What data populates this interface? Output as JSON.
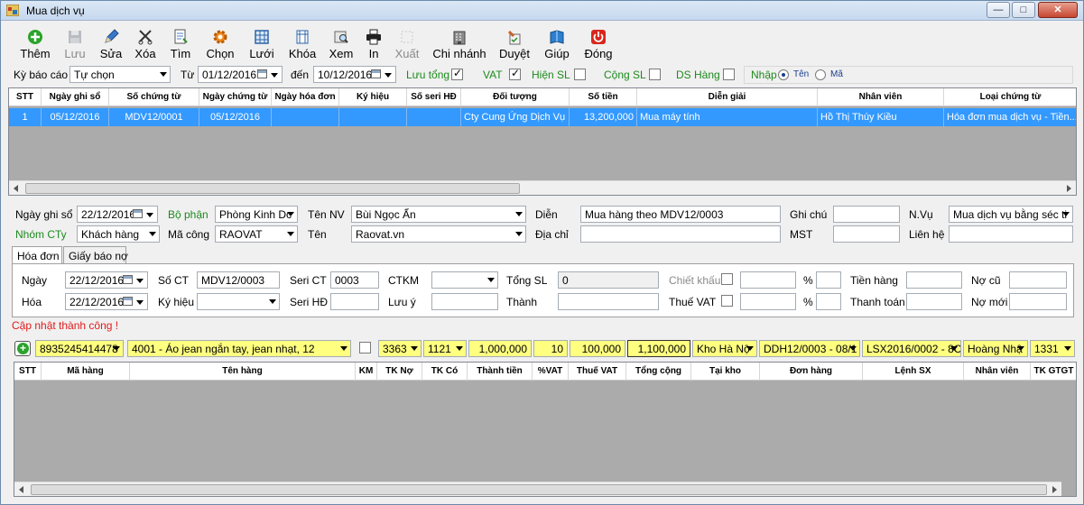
{
  "window": {
    "title": "Mua dịch vụ",
    "min": "—",
    "max": "□",
    "close": "✕"
  },
  "toolbar": {
    "them": "Thêm",
    "luu": "Lưu",
    "sua": "Sửa",
    "xoa": "Xóa",
    "tim": "Tìm",
    "chon": "Chọn",
    "luoi": "Lưới",
    "khoa": "Khóa",
    "xem": "Xem",
    "in": "In",
    "xuat": "Xuất",
    "chinhanh": "Chi nhánh",
    "duyet": "Duyệt",
    "giup": "Giúp",
    "dong": "Đóng"
  },
  "filter": {
    "ky_bao_cao_label": "Kỳ báo cáo",
    "ky_bao_cao_value": "Tự chọn",
    "tu_label": "Từ",
    "tu_value": "01/12/2016",
    "den_label": "đến",
    "den_value": "10/12/2016",
    "luu_tong": "Lưu tổng",
    "vat": "VAT",
    "hien_sl": "Hiện SL",
    "cong_sl": "Cộng SL",
    "ds_hang": "DS Hàng",
    "nhap": "Nhập",
    "ten": "Tên",
    "ma": "Mã"
  },
  "master_grid": {
    "headers": [
      "STT",
      "Ngày ghi sổ",
      "Số chứng từ",
      "Ngày chứng từ",
      "Ngày hóa đơn",
      "Ký hiệu",
      "Số seri HĐ",
      "Đối tượng",
      "Số tiền",
      "Diễn giải",
      "Nhân viên",
      "Loại chứng từ"
    ],
    "rows": [
      [
        "1",
        "05/12/2016",
        "MDV12/0001",
        "05/12/2016",
        "",
        "",
        "",
        "Cty Cung Ứng Dịch Vụ",
        "13,200,000",
        "Mua máy tính",
        "Hồ Thị Thúy Kiều",
        "Hóa đơn mua dịch vụ - Tiền..."
      ]
    ]
  },
  "form": {
    "ngay_ghi_so_label": "Ngày ghi sổ",
    "ngay_ghi_so": "22/12/2016",
    "bo_phan_label": "Bộ phận",
    "bo_phan": "Phòng Kinh Dc",
    "ten_nv_label": "Tên NV",
    "ten_nv": "Bùi Ngọc Ẩn",
    "dien_label": "Diễn",
    "dien": "Mua hàng theo MDV12/0003",
    "ghi_chu_label": "Ghi chú",
    "ghi_chu": "",
    "nvu_label": "N.Vụ",
    "nvu": "Mua dịch vụ bằng séc ti",
    "nhom_cty_label": "Nhóm CTy",
    "nhom_cty": "Khách hàng",
    "ma_cong_label": "Mã công",
    "ma_cong": "RAOVAT",
    "ten_label": "Tên",
    "ten": "Raovat.vn",
    "dia_chi_label": "Địa chỉ",
    "dia_chi": "",
    "mst_label": "MST",
    "mst": "",
    "lien_he_label": "Liên hệ",
    "lien_he": ""
  },
  "tabs": {
    "hoa_don": "Hóa đơn",
    "giay_bao_no": "Giấy báo nợ"
  },
  "invoice": {
    "ngay_label": "Ngày",
    "ngay": "22/12/2016",
    "so_ct_label": "Số CT",
    "so_ct": "MDV12/0003",
    "seri_ct_label": "Seri CT",
    "seri_ct": "0003",
    "ctkm_label": "CTKM",
    "ctkm": "",
    "tong_sl_label": "Tổng SL",
    "tong_sl": "0",
    "chiet_khau_label": "Chiết khấu",
    "pct1": "%",
    "tien_hang_label": "Tiền hàng",
    "no_cu_label": "Nợ cũ",
    "hoa_label": "Hóa",
    "hoa": "22/12/2016",
    "ky_hieu_label": "Ký hiệu",
    "seri_hd_label": "Seri HĐ",
    "luu_y_label": "Lưu ý",
    "thanh_label": "Thành",
    "thue_vat_label": "Thuế VAT",
    "pct2": "%",
    "thanh_toan_label": "Thanh toán",
    "no_moi_label": "Nợ mới"
  },
  "status": "Cập nhật thành công !",
  "entry": {
    "add": "+",
    "barcode": "8935245414478",
    "item": "4001 - Áo jean ngắn tay, jean nhạt, 12",
    "tk_no": "3363",
    "tk_co": "1121",
    "thanh_tien": "1,000,000",
    "vat": "10",
    "thue": "100,000",
    "tong": "1,100,000",
    "kho": "Kho Hà Nộ",
    "don_hang": "DDH12/0003 - 08/1",
    "lenh_sx": "LSX2016/0002 - 8C",
    "nhan_vien": "Hoàng Nhậ",
    "tk_gtgt": "1331"
  },
  "detail_grid": {
    "headers": [
      "STT",
      "Mã hàng",
      "Tên hàng",
      "KM",
      "TK Nợ",
      "TK Có",
      "Thành tiền",
      "%VAT",
      "Thuế VAT",
      "Tổng cộng",
      "Tại kho",
      "Đơn hàng",
      "Lệnh SX",
      "Nhân viên",
      "TK GTGT"
    ]
  },
  "colors": {
    "selection": "#3399ff",
    "highlight": "#ffff80",
    "status": "#e01b1b",
    "green_label": "#1d8a1d"
  }
}
